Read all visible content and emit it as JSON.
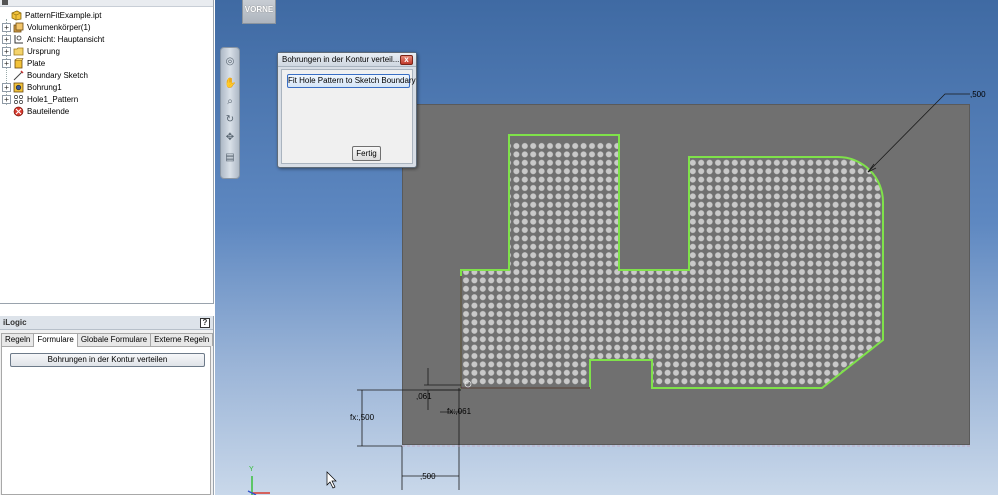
{
  "browser": {
    "items": [
      {
        "label": "PatternFitExample.ipt",
        "icon": "part-icon",
        "expand": "none",
        "indent": 0
      },
      {
        "label": "Volumenkörper(1)",
        "icon": "solid-bodies-icon",
        "expand": "+",
        "indent": 1
      },
      {
        "label": "Ansicht: Hauptansicht",
        "icon": "view-icon",
        "expand": "+",
        "indent": 1
      },
      {
        "label": "Ursprung",
        "icon": "folder-icon",
        "expand": "+",
        "indent": 1
      },
      {
        "label": "Plate",
        "icon": "extrusion-icon",
        "expand": "+",
        "indent": 1
      },
      {
        "label": "Boundary Sketch",
        "icon": "sketch-icon",
        "expand": "none",
        "indent": 1
      },
      {
        "label": "Bohrung1",
        "icon": "hole-icon",
        "expand": "+",
        "indent": 1
      },
      {
        "label": "Hole1_Pattern",
        "icon": "pattern-icon",
        "expand": "+",
        "indent": 1
      },
      {
        "label": "Bauteilende",
        "icon": "end-of-part-icon",
        "expand": "none",
        "indent": 1
      }
    ]
  },
  "ilogic": {
    "title": "iLogic",
    "help": "?",
    "tabs": [
      "Regeln",
      "Formulare",
      "Globale Formulare",
      "Externe Regeln"
    ],
    "active_tab": "Formulare",
    "form_button": "Bohrungen in der Kontur verteilen"
  },
  "viewport": {
    "viewcube_label": "VORNE"
  },
  "dialog": {
    "title": "Bohrungen in der Kontur verteil...",
    "fit_button": "Fit Hole Pattern to Sketch Boundary",
    "ok_button": "Fertig"
  },
  "dimensions": {
    "radius": ",500",
    "offset_v": ",061",
    "offset_h": "fx:,061",
    "edge_v": "fx:,500",
    "edge_h": ",500"
  },
  "axis": {
    "y_label": "Y",
    "x_label": "X"
  },
  "colors": {
    "boundary": "#7fe24a",
    "plate": "#707070",
    "hole_fill": "#c9c9c9",
    "constraint_line": "#5b2a55"
  }
}
